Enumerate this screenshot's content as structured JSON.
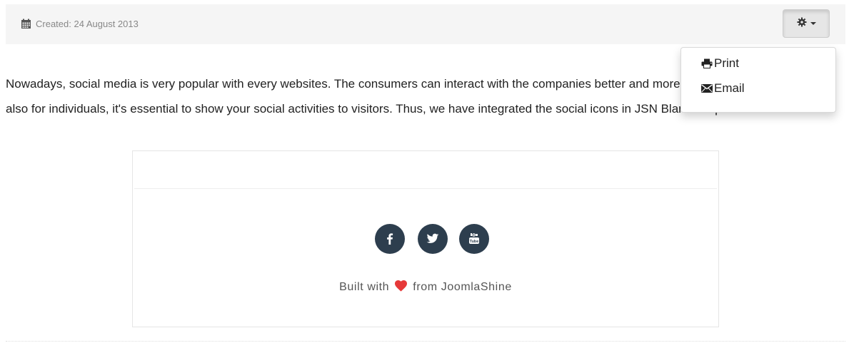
{
  "article_info": {
    "created_label": "Created: 24 August 2013"
  },
  "tools_menu": {
    "items": [
      {
        "label": "Print",
        "icon": "print-icon"
      },
      {
        "label": "Email",
        "icon": "envelope-icon"
      }
    ]
  },
  "article": {
    "body": "Nowadays, social media is very popular with every websites. The consumers can interact with the companies better and more directly for businesses but also for individuals, it's essential to show your social activities to visitors. Thus, we have integrated the social icons in JSN Blank template ."
  },
  "footer_module": {
    "social_icons": [
      "facebook-icon",
      "twitter-icon",
      "youtube-icon"
    ],
    "built_with_prefix": "Built with",
    "built_with_suffix": "from JoomlaShine",
    "heart_color": "#e63939",
    "icon_bg_color": "#2d3e4e"
  }
}
